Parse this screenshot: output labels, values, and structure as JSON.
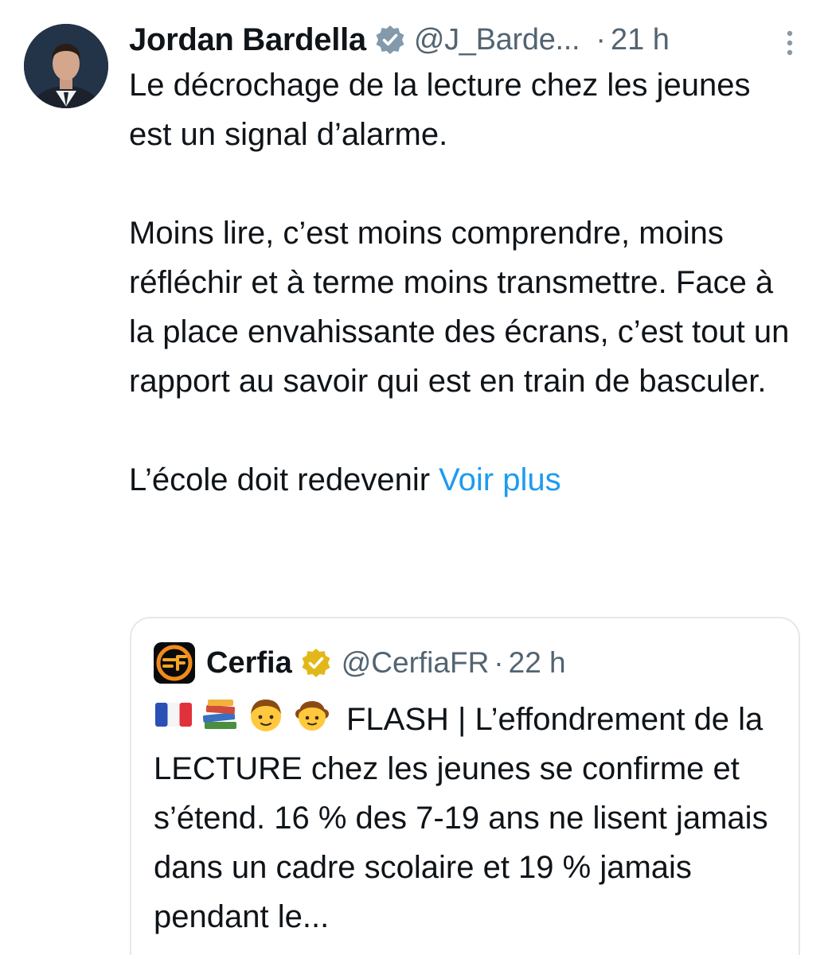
{
  "tweet": {
    "author_name": "Jordan Bardella",
    "handle": "@J_Barde...",
    "separator": "·",
    "time": "21 h",
    "paragraph_1": "Le décrochage de la lecture chez les jeunes est un signal d’alarme.",
    "paragraph_2": "Moins lire, c’est moins comprendre, moins réfléchir et à terme moins transmettre. Face à la place envahissante des écrans, c’est tout un rapport au savoir qui est en train de basculer.",
    "paragraph_3": "L’école doit redevenir",
    "voir_plus": "Voir plus",
    "more_icon": "vertical-ellipsis-icon",
    "verified_icon": "verified-badge-icon"
  },
  "quote": {
    "author_name": "Cerfia",
    "handle": "@CerfiaFR",
    "separator": "·",
    "time": "22 h",
    "emojis": [
      "france-flag-icon",
      "books-icon",
      "boy-icon",
      "girl-icon"
    ],
    "text": "FLASH | L’effondrement de la LECTURE chez les jeunes se confirme et s’étend. 16 % des 7-19 ans ne lisent jamais dans un cadre scolaire et 19 % jamais pendant le...",
    "logo_icon": "cerfia-logo-icon",
    "verified_icon": "gold-verified-badge-icon"
  },
  "colors": {
    "text": "#0f1419",
    "secondary": "#536471",
    "link": "#1d9bf0",
    "verified_blue": "#829aab",
    "verified_gold": "#e2b719",
    "border": "#e4e8eb"
  }
}
